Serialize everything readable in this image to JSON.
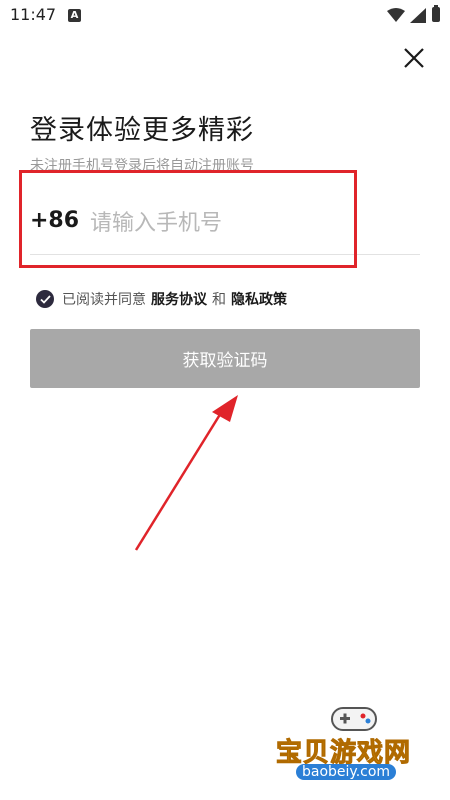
{
  "status_bar": {
    "time": "11:47",
    "a_badge": "A"
  },
  "page": {
    "title": "登录体验更多精彩",
    "subtitle": "未注册手机号登录后将自动注册账号"
  },
  "phone": {
    "country_code": "+86",
    "placeholder": "请输入手机号",
    "value": ""
  },
  "agreement": {
    "checked": true,
    "prefix": "已阅读并同意",
    "service_label": "服务协议",
    "and_label": "和",
    "privacy_label": "隐私政策"
  },
  "actions": {
    "get_code_label": "获取验证码"
  },
  "annotation": {
    "highlight_color": "#e0242a",
    "arrow_color": "#e0242a"
  },
  "watermark": {
    "title": "宝贝游戏网",
    "url": "baobeiy.com"
  },
  "colors": {
    "button_disabled": "#a8a8a8",
    "check_fill": "#2d2a3e"
  }
}
